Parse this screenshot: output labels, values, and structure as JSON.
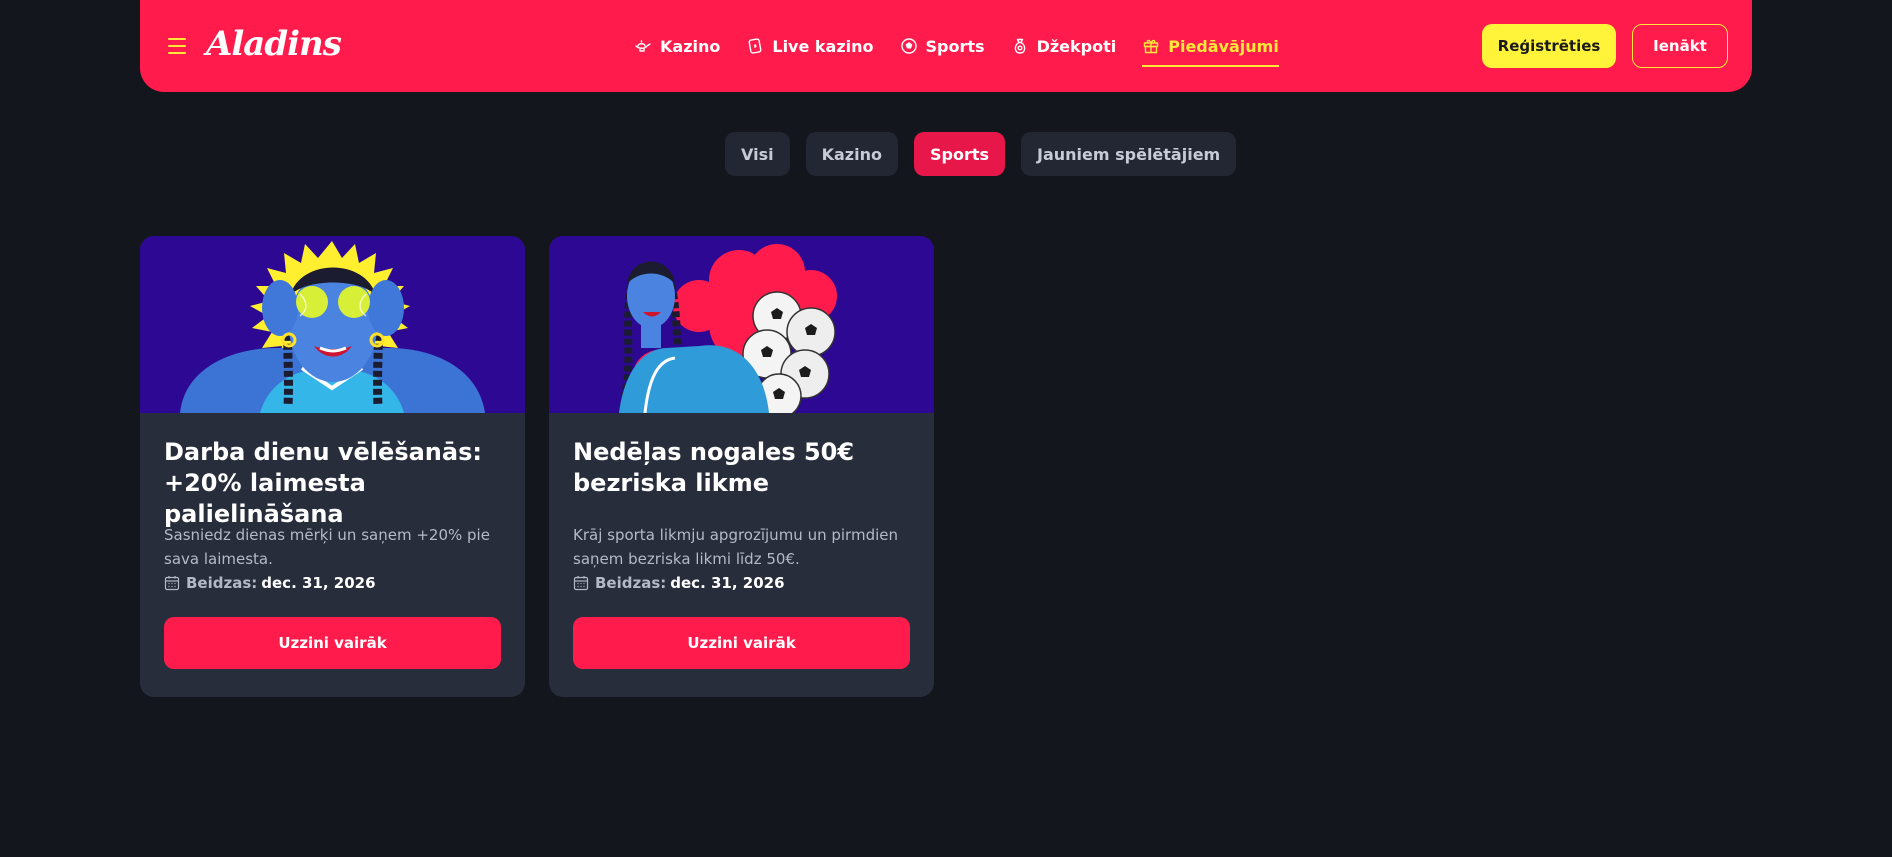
{
  "header": {
    "logo_text": "Aladins",
    "nav": [
      {
        "label": "Kazino",
        "icon": "genie-lamp-icon"
      },
      {
        "label": "Live kazino",
        "icon": "playing-card-icon"
      },
      {
        "label": "Sports",
        "icon": "soccer-ball-icon"
      },
      {
        "label": "Džekpoti",
        "icon": "money-bag-icon"
      },
      {
        "label": "Piedāvājumi",
        "icon": "gift-icon",
        "active": true
      }
    ],
    "register_label": "Reģistrēties",
    "login_label": "Ienākt"
  },
  "filters": [
    {
      "label": "Visi"
    },
    {
      "label": "Kazino"
    },
    {
      "label": "Sports",
      "active": true
    },
    {
      "label": "Jauniem spēlētājiem"
    }
  ],
  "cards": [
    {
      "title": "Darba dienu vēlēšanās: +20% laimesta palielināšana",
      "description": "Sasniedz dienas mērķi un saņem +20% pie sava laimesta.",
      "expiry_label": "Beidzas:",
      "expiry_date": "dec. 31, 2026",
      "button_label": "Uzzini vairāk"
    },
    {
      "title": "Nedēļas nogales 50€ bezriska likme",
      "description": "Krāj sporta likmju apgrozījumu un pirmdien saņem bezriska likmi līdz 50€.",
      "expiry_label": "Beidzas:",
      "expiry_date": "dec. 31, 2026",
      "button_label": "Uzzini vairāk"
    }
  ],
  "colors": {
    "page_bg": "#14161d",
    "header_bg": "#ff1c4d",
    "accent_yellow": "#ffe83a",
    "card_bg": "#272d3a",
    "chip_bg": "#232733",
    "chip_active_bg": "#e8174a",
    "image_bg": "#2d0993"
  }
}
